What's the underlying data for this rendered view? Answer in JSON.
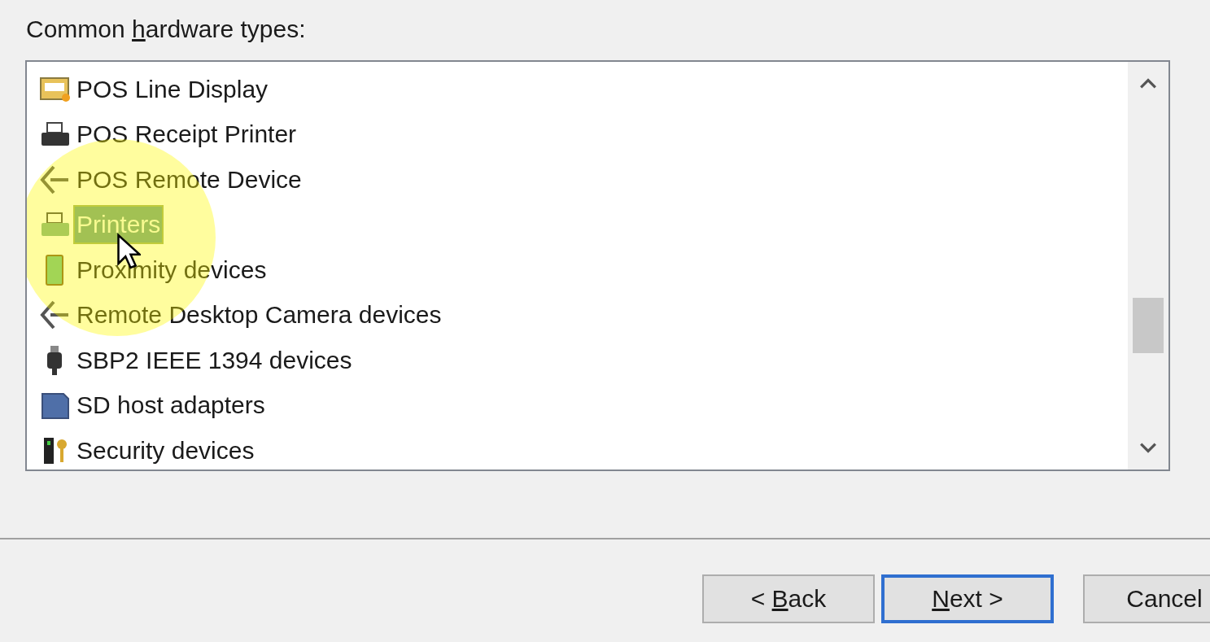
{
  "label": {
    "before": "Common ",
    "key": "h",
    "after": "ardware types:"
  },
  "hardware_types": [
    {
      "label": "POS Line Display",
      "selected": false
    },
    {
      "label": "POS Receipt Printer",
      "selected": false
    },
    {
      "label": "POS Remote Device",
      "selected": false
    },
    {
      "label": "Printers",
      "selected": true
    },
    {
      "label": "Proximity devices",
      "selected": false
    },
    {
      "label": "Remote Desktop Camera devices",
      "selected": false
    },
    {
      "label": "SBP2 IEEE 1394 devices",
      "selected": false
    },
    {
      "label": "SD host adapters",
      "selected": false
    },
    {
      "label": "Security devices",
      "selected": false
    }
  ],
  "buttons": [
    {
      "before": "< ",
      "key": "B",
      "after": "ack",
      "default": false
    },
    {
      "key": "N",
      "after": "ext >",
      "default": true
    },
    {
      "before": "Cancel",
      "default": false
    }
  ]
}
